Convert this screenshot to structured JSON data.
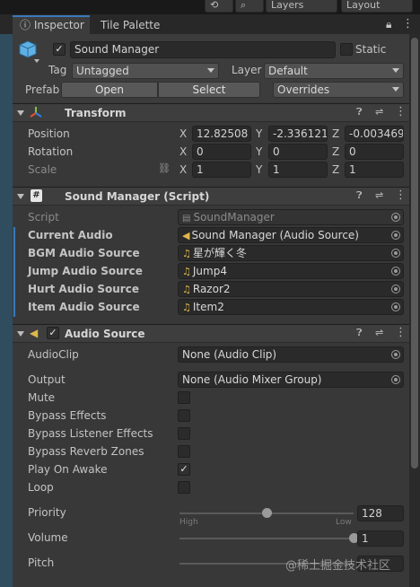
{
  "toolbar": {
    "layers": "Layers",
    "layout": "Layout"
  },
  "tabs": [
    {
      "label": "Inspector"
    },
    {
      "label": "Tile Palette"
    }
  ],
  "gameobject": {
    "name": "Sound Manager",
    "static_label": "Static",
    "tag_label": "Tag",
    "tag_value": "Untagged",
    "layer_label": "Layer",
    "layer_value": "Default",
    "prefab_label": "Prefab",
    "open": "Open",
    "select": "Select",
    "overrides": "Overrides"
  },
  "transform": {
    "title": "Transform",
    "position": {
      "label": "Position",
      "x": "12.82508",
      "y": "-2.336121",
      "z": "-0.003469"
    },
    "rotation": {
      "label": "Rotation",
      "x": "0",
      "y": "0",
      "z": "0"
    },
    "scale": {
      "label": "Scale",
      "x": "1",
      "y": "1",
      "z": "1"
    },
    "axes": {
      "x": "X",
      "y": "Y",
      "z": "Z"
    }
  },
  "script_comp": {
    "title": "Sound Manager (Script)",
    "script_label": "Script",
    "script_value": "SoundManager",
    "current_audio_label": "Current Audio",
    "current_audio_value": "Sound Manager (Audio Source)",
    "bgm_label": "BGM Audio Source",
    "bgm_value": "星が輝く冬",
    "jump_label": "Jump Audio Source",
    "jump_value": "Jump4",
    "hurt_label": "Hurt Audio Source",
    "hurt_value": "Razor2",
    "item_label": "Item Audio Source",
    "item_value": "Item2"
  },
  "audio_source": {
    "title": "Audio Source",
    "clip_label": "AudioClip",
    "clip_value": "None (Audio Clip)",
    "output_label": "Output",
    "output_value": "None (Audio Mixer Group)",
    "mute": "Mute",
    "bypass_effects": "Bypass Effects",
    "bypass_listener": "Bypass Listener Effects",
    "bypass_reverb": "Bypass Reverb Zones",
    "play_on_awake": "Play On Awake",
    "loop": "Loop",
    "priority_label": "Priority",
    "priority_value": "128",
    "priority_level": 0.5,
    "high": "High",
    "low": "Low",
    "volume_label": "Volume",
    "volume_value": "1",
    "volume_level": 1.0,
    "pitch_label": "Pitch"
  },
  "watermark": "@稀土掘金技术社区"
}
